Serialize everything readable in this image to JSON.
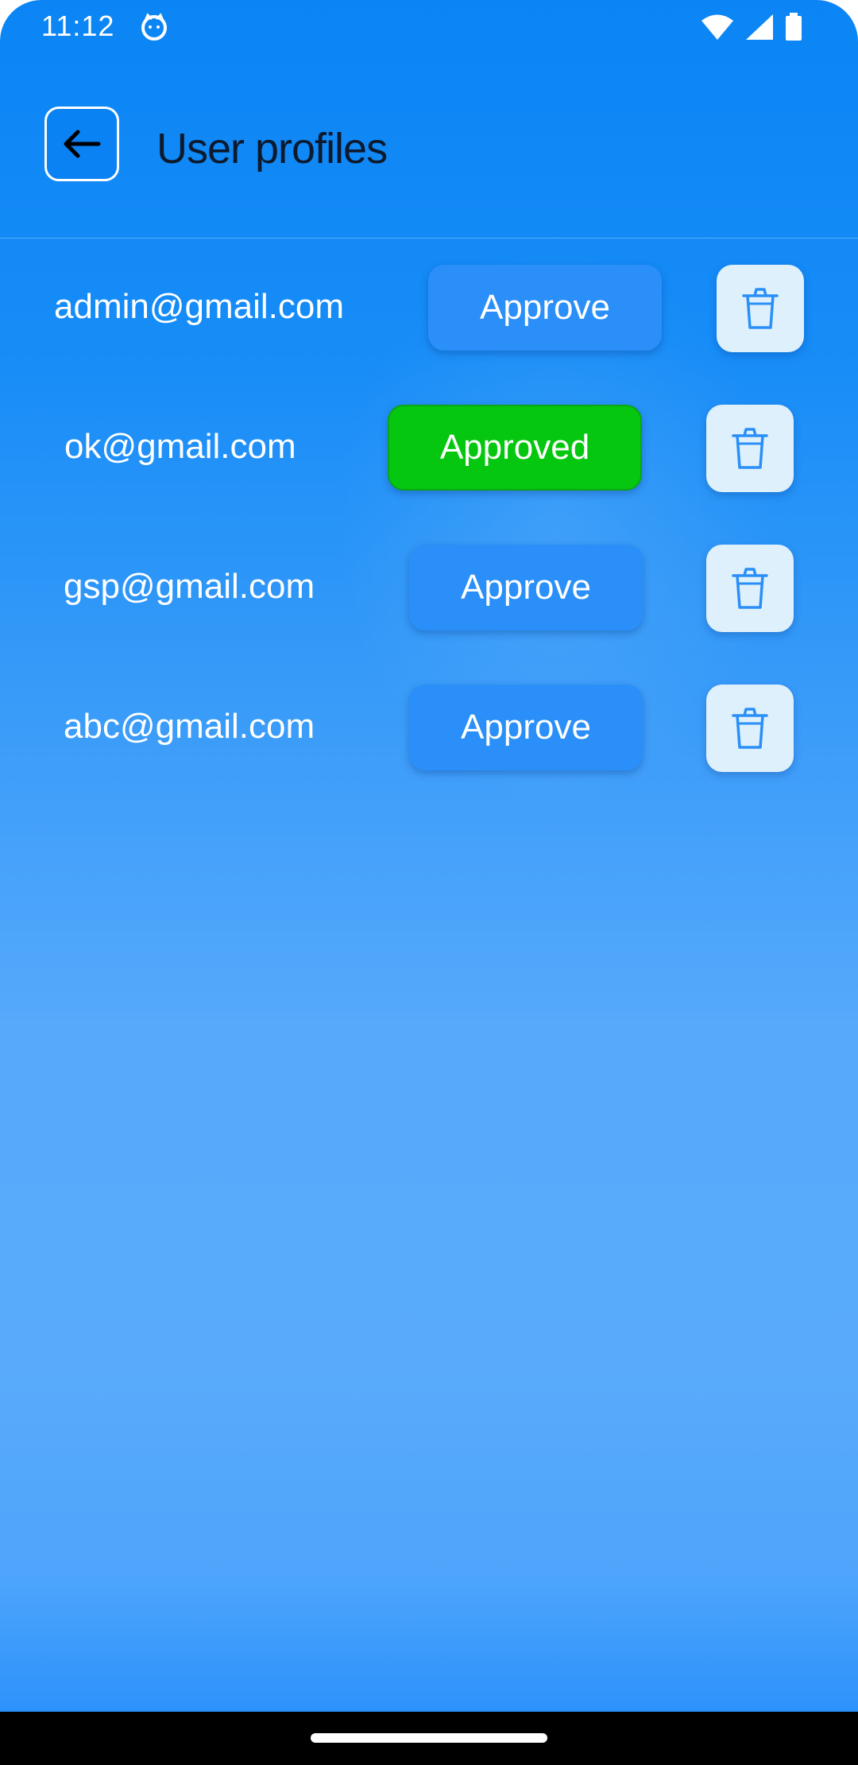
{
  "status_bar": {
    "time": "11:12",
    "app_icon": "cat-face-icon",
    "icons": [
      "wifi-icon",
      "cellular-signal-icon",
      "battery-icon"
    ]
  },
  "header": {
    "title": "User profiles",
    "back_icon": "arrow-left-icon"
  },
  "users": [
    {
      "email": "admin@gmail.com",
      "action_label": "Approve",
      "approved": false
    },
    {
      "email": "ok@gmail.com",
      "action_label": "Approved",
      "approved": true
    },
    {
      "email": "gsp@gmail.com",
      "action_label": "Approve",
      "approved": false
    },
    {
      "email": "abc@gmail.com",
      "action_label": "Approve",
      "approved": false
    }
  ],
  "delete_icon": "trash-icon",
  "colors": {
    "background_top": "#0b85f5",
    "background_bottom": "#56a9fb",
    "approve_button": "#2a8ff8",
    "approved_button": "#06c70f",
    "delete_button": "#dff0fd",
    "delete_icon": "#2a8ff8",
    "title_text": "#0d1a2e"
  }
}
